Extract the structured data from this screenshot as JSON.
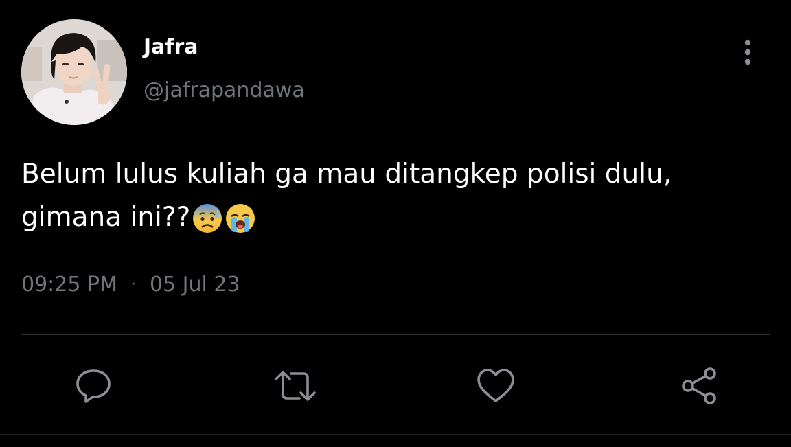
{
  "tweet": {
    "display_name": "Jafra",
    "handle": "@jafrapandawa",
    "text_line1": "Belum lulus kuliah ga mau ditangkep polisi dulu,",
    "text_line2": "gimana ini??",
    "emojis": [
      "anxious-face-with-sweat",
      "loudly-crying-face"
    ],
    "time": "09:25 PM",
    "separator": "·",
    "date": "05 Jul 23"
  },
  "header": {
    "more_icon": "vertical-ellipsis-icon"
  },
  "actions": [
    {
      "name": "reply",
      "icon": "speech-bubble-icon"
    },
    {
      "name": "retweet",
      "icon": "retweet-arrows-icon"
    },
    {
      "name": "like",
      "icon": "heart-outline-icon"
    },
    {
      "name": "share",
      "icon": "share-nodes-icon"
    }
  ],
  "colors": {
    "background": "#000000",
    "primary_text": "#ffffff",
    "secondary_text": "#71767b",
    "divider": "#2f3336"
  }
}
